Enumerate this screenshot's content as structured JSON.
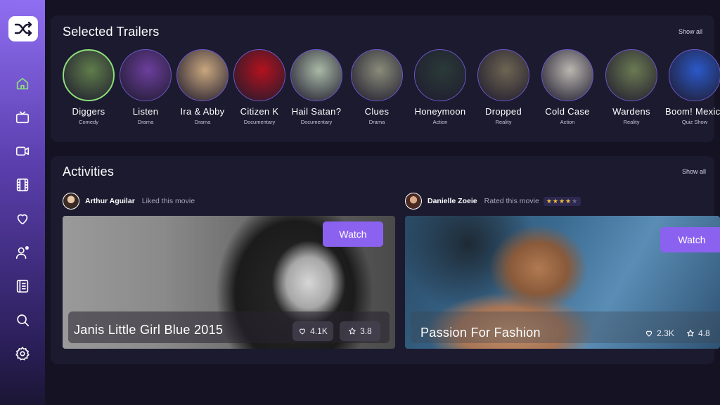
{
  "nav": {
    "logo_icon": "shuffle-icon",
    "items": [
      {
        "icon": "home-icon",
        "active": true
      },
      {
        "icon": "tv-icon"
      },
      {
        "icon": "video-icon"
      },
      {
        "icon": "film-icon"
      },
      {
        "icon": "heart-icon"
      },
      {
        "icon": "user-star-icon"
      },
      {
        "icon": "notes-icon"
      },
      {
        "icon": "search-icon"
      },
      {
        "icon": "settings-icon"
      }
    ]
  },
  "trailers": {
    "title": "Selected Trailers",
    "show_all": "Show all",
    "items": [
      {
        "title": "Diggers",
        "genre": "Comedy",
        "active": true,
        "color": "#5f7d4a"
      },
      {
        "title": "Listen",
        "genre": "Drama",
        "color": "#6b3e9c"
      },
      {
        "title": "Ira & Abby",
        "genre": "Drama",
        "color": "#c9a77e"
      },
      {
        "title": "Citizen K",
        "genre": "Documentary",
        "color": "#b3121e"
      },
      {
        "title": "Hail Satan?",
        "genre": "Documentary",
        "color": "#a9b9a6"
      },
      {
        "title": "Clues",
        "genre": "Drama",
        "color": "#8a8c7a"
      },
      {
        "title": "Honeymoon",
        "genre": "Action",
        "color": "#2a3a38"
      },
      {
        "title": "Dropped",
        "genre": "Reality",
        "color": "#6d6552"
      },
      {
        "title": "Cold Case",
        "genre": "Action",
        "color": "#b9b6b0"
      },
      {
        "title": "Wardens",
        "genre": "Reality",
        "color": "#6b7a52"
      },
      {
        "title": "Boom! Mexico",
        "genre": "Quiz Show",
        "color": "#2b59c8"
      }
    ]
  },
  "activities": {
    "title": "Activities",
    "show_all": "Show all",
    "items": [
      {
        "user": "Arthur Aguilar",
        "action": "Liked this movie",
        "stars": null,
        "watch_label": "Watch",
        "movie_title": "Janis Little Girl Blue 2015",
        "likes": "4.1K",
        "rating": "3.8"
      },
      {
        "user": "Danielle Zoeie",
        "action": "Rated this movie",
        "stars": {
          "filled": "★★★★",
          "empty": "★",
          "value": 4,
          "max": 5
        },
        "watch_label": "Watch",
        "movie_title": "Passion For Fashion",
        "likes": "2.3K",
        "rating": "4.8"
      }
    ]
  }
}
